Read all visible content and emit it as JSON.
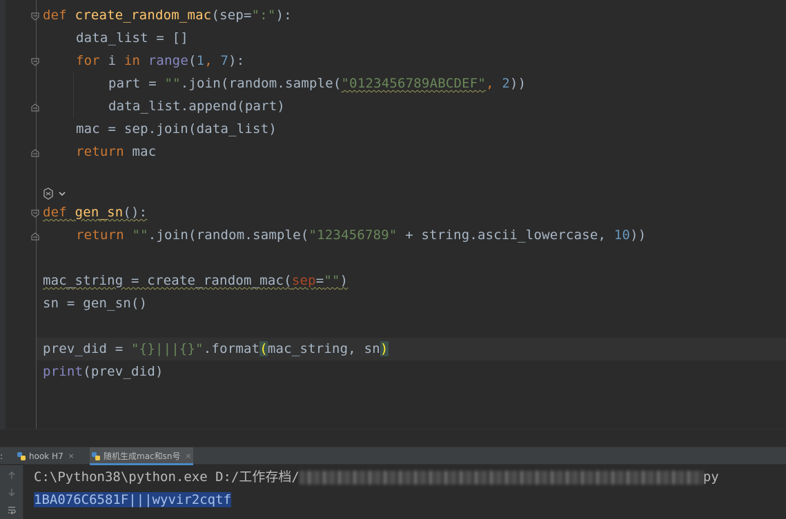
{
  "editor": {
    "lines": {
      "l1": {
        "kw": "def ",
        "fn": "create_random_mac",
        "p1": "(",
        "param": "sep",
        "eq": "=",
        "str": "\":\"",
        "p2": "):"
      },
      "l2": "data_list = []",
      "l3": {
        "kw1": "for ",
        "a": "i ",
        "kw2": "in ",
        "bi": "range",
        "b": "(",
        "n1": "1",
        "c": ", ",
        "n2": "7",
        "d": "):"
      },
      "l4": {
        "a": "part = ",
        "s1": "\"\"",
        "b": ".join(random.sample(",
        "s2": "\"0123456789ABCDEF\"",
        "c": ", ",
        "n": "2",
        "d": "))"
      },
      "l5": "data_list.append(part)",
      "l6": "mac = sep.join(data_list)",
      "l7": {
        "kw": "return ",
        "a": "mac"
      },
      "l8": {
        "kw": "def ",
        "fn": "gen_sn",
        "a": "():"
      },
      "l9": {
        "kw": "return ",
        "s1": "\"\"",
        "b": ".join(random.sample(",
        "s2": "\"123456789\"",
        "c": " + string.ascii_lowercase, ",
        "n": "10",
        "d": "))"
      },
      "l10": {
        "a": "mac_string = create_random_mac(",
        "param": "sep",
        "eq": "=",
        "s": "\"\"",
        "b": ")"
      },
      "l11": "sn = gen_sn()",
      "l12": {
        "a": "prev_did = ",
        "s": "\"{}|||{}\"",
        "b": ".format",
        "br1": "(",
        "c": "mac_string, sn",
        "br2": ")"
      },
      "l13": {
        "bi": "print",
        "a": "(prev_did)"
      }
    }
  },
  "run_panel": {
    "prefix": ":",
    "tabs": [
      {
        "label": "hook H7",
        "close": "×"
      },
      {
        "label": "随机生成mac和sn号",
        "close": "×"
      }
    ]
  },
  "console": {
    "command_prefix": "C:\\Python38\\python.exe D:/工作存档/",
    "command_suffix": "py",
    "output": "1BA076C6581F|||wyvir2cqtf"
  },
  "colors": {
    "background": "#2b2b2b",
    "keyword": "#cc7832",
    "function": "#ffc66d",
    "string": "#6a8759",
    "number": "#6897bb",
    "selection": "#214283"
  },
  "icons": [
    "fold-marker-icon",
    "ai-assistant-icon",
    "python-file-icon",
    "close-icon",
    "arrow-up-icon",
    "arrow-down-icon",
    "soft-wrap-icon"
  ]
}
